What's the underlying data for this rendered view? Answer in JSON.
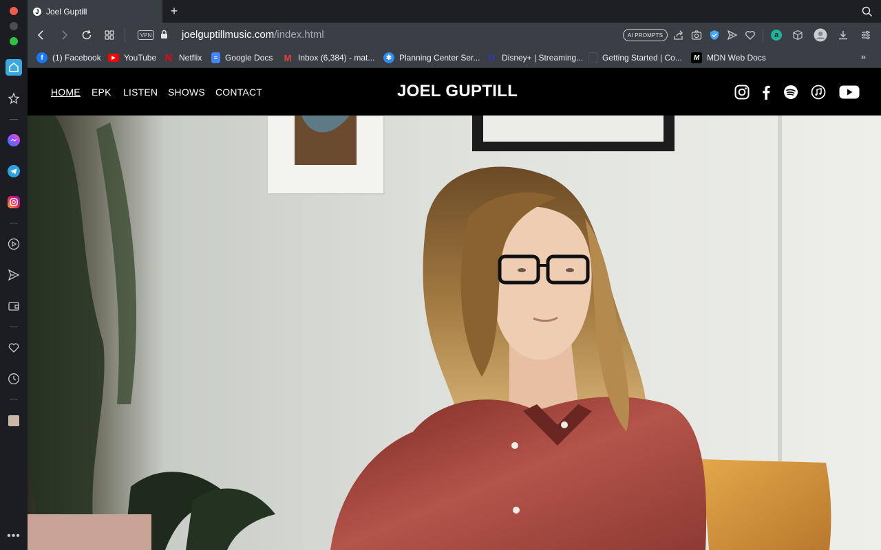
{
  "tab": {
    "title": "Joel Guptill",
    "favicon_letter": "J"
  },
  "address": {
    "vpn_label": "VPN",
    "url_host": "joelguptillmusic.com",
    "url_path": "/index.html",
    "ai_prompts_label": "AI PROMPTS"
  },
  "bookmarks": [
    {
      "label": "(1) Facebook",
      "icon": "facebook-icon"
    },
    {
      "label": "YouTube",
      "icon": "youtube-icon"
    },
    {
      "label": "Netflix",
      "icon": "netflix-icon"
    },
    {
      "label": "Google Docs",
      "icon": "google-docs-icon"
    },
    {
      "label": "Inbox (6,384) - mat...",
      "icon": "gmail-icon"
    },
    {
      "label": "Planning Center Ser...",
      "icon": "planning-center-icon"
    },
    {
      "label": "Disney+ | Streaming...",
      "icon": "disney-plus-icon"
    },
    {
      "label": "Getting Started | Co...",
      "icon": "getting-started-icon"
    },
    {
      "label": "MDN Web Docs",
      "icon": "mdn-icon"
    }
  ],
  "site": {
    "nav": [
      "HOME",
      "EPK",
      "LISTEN",
      "SHOWS",
      "CONTACT"
    ],
    "logo": "JOEL GUPTILL",
    "social_icons": [
      "instagram-icon",
      "facebook-icon",
      "spotify-icon",
      "apple-music-icon",
      "youtube-icon"
    ]
  },
  "colors": {
    "accent": "#3aa9e0",
    "toolbar": "#3a3e45",
    "site_bg": "#000000"
  }
}
